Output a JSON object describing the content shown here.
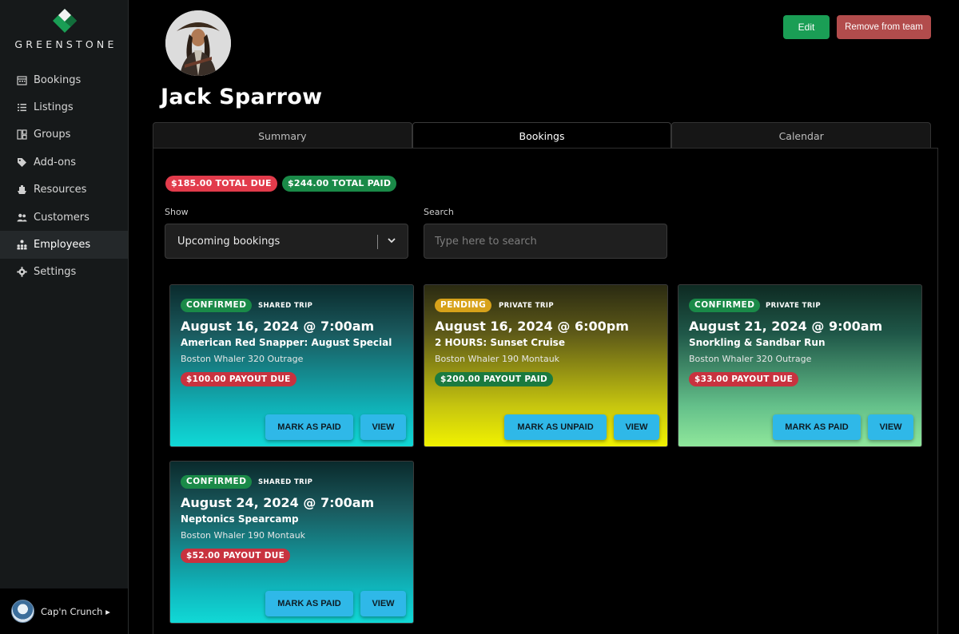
{
  "brand": {
    "name": "GREENSTONE"
  },
  "sidebar": {
    "items": [
      {
        "label": "Bookings",
        "icon": "calendar-icon"
      },
      {
        "label": "Listings",
        "icon": "list-icon"
      },
      {
        "label": "Groups",
        "icon": "groups-icon"
      },
      {
        "label": "Add-ons",
        "icon": "tag-icon"
      },
      {
        "label": "Resources",
        "icon": "boat-icon"
      },
      {
        "label": "Customers",
        "icon": "people-icon"
      },
      {
        "label": "Employees",
        "icon": "org-chart-icon",
        "active": true
      },
      {
        "label": "Settings",
        "icon": "gear-icon"
      }
    ],
    "user": {
      "name": "Cap'n Crunch ▸"
    }
  },
  "profile": {
    "name": "Jack Sparrow"
  },
  "actions": {
    "edit": "Edit",
    "remove": "Remove from team"
  },
  "tabs": [
    {
      "label": "Summary"
    },
    {
      "label": "Bookings",
      "active": true
    },
    {
      "label": "Calendar"
    }
  ],
  "totals": {
    "due": "$185.00 TOTAL DUE",
    "paid": "$244.00 TOTAL PAID"
  },
  "filters": {
    "show_label": "Show",
    "show_value": "Upcoming bookings",
    "search_label": "Search",
    "search_placeholder": "Type here to search"
  },
  "bookings": [
    {
      "status": "CONFIRMED",
      "trip": "SHARED TRIP",
      "date": "August 16, 2024 @ 7:00am",
      "name": "American Red Snapper: August Special",
      "boat": "Boston Whaler 320 Outrage",
      "payout": "$100.00 PAYOUT DUE",
      "mark": "MARK AS PAID",
      "view": "VIEW"
    },
    {
      "status": "PENDING",
      "trip": "PRIVATE TRIP",
      "date": "August 16, 2024 @ 6:00pm",
      "name": "2 HOURS: Sunset Cruise",
      "boat": "Boston Whaler 190 Montauk",
      "payout": "$200.00 PAYOUT PAID",
      "mark": "MARK AS UNPAID",
      "view": "VIEW"
    },
    {
      "status": "CONFIRMED",
      "trip": "PRIVATE TRIP",
      "date": "August 21, 2024 @ 9:00am",
      "name": "Snorkling & Sandbar Run",
      "boat": "Boston Whaler 320 Outrage",
      "payout": "$33.00 PAYOUT DUE",
      "mark": "MARK AS PAID",
      "view": "VIEW"
    },
    {
      "status": "CONFIRMED",
      "trip": "SHARED TRIP",
      "date": "August 24, 2024 @ 7:00am",
      "name": "Neptonics Spearcamp",
      "boat": "Boston Whaler 190 Montauk",
      "payout": "$52.00 PAYOUT DUE",
      "mark": "MARK AS PAID",
      "view": "VIEW"
    }
  ]
}
